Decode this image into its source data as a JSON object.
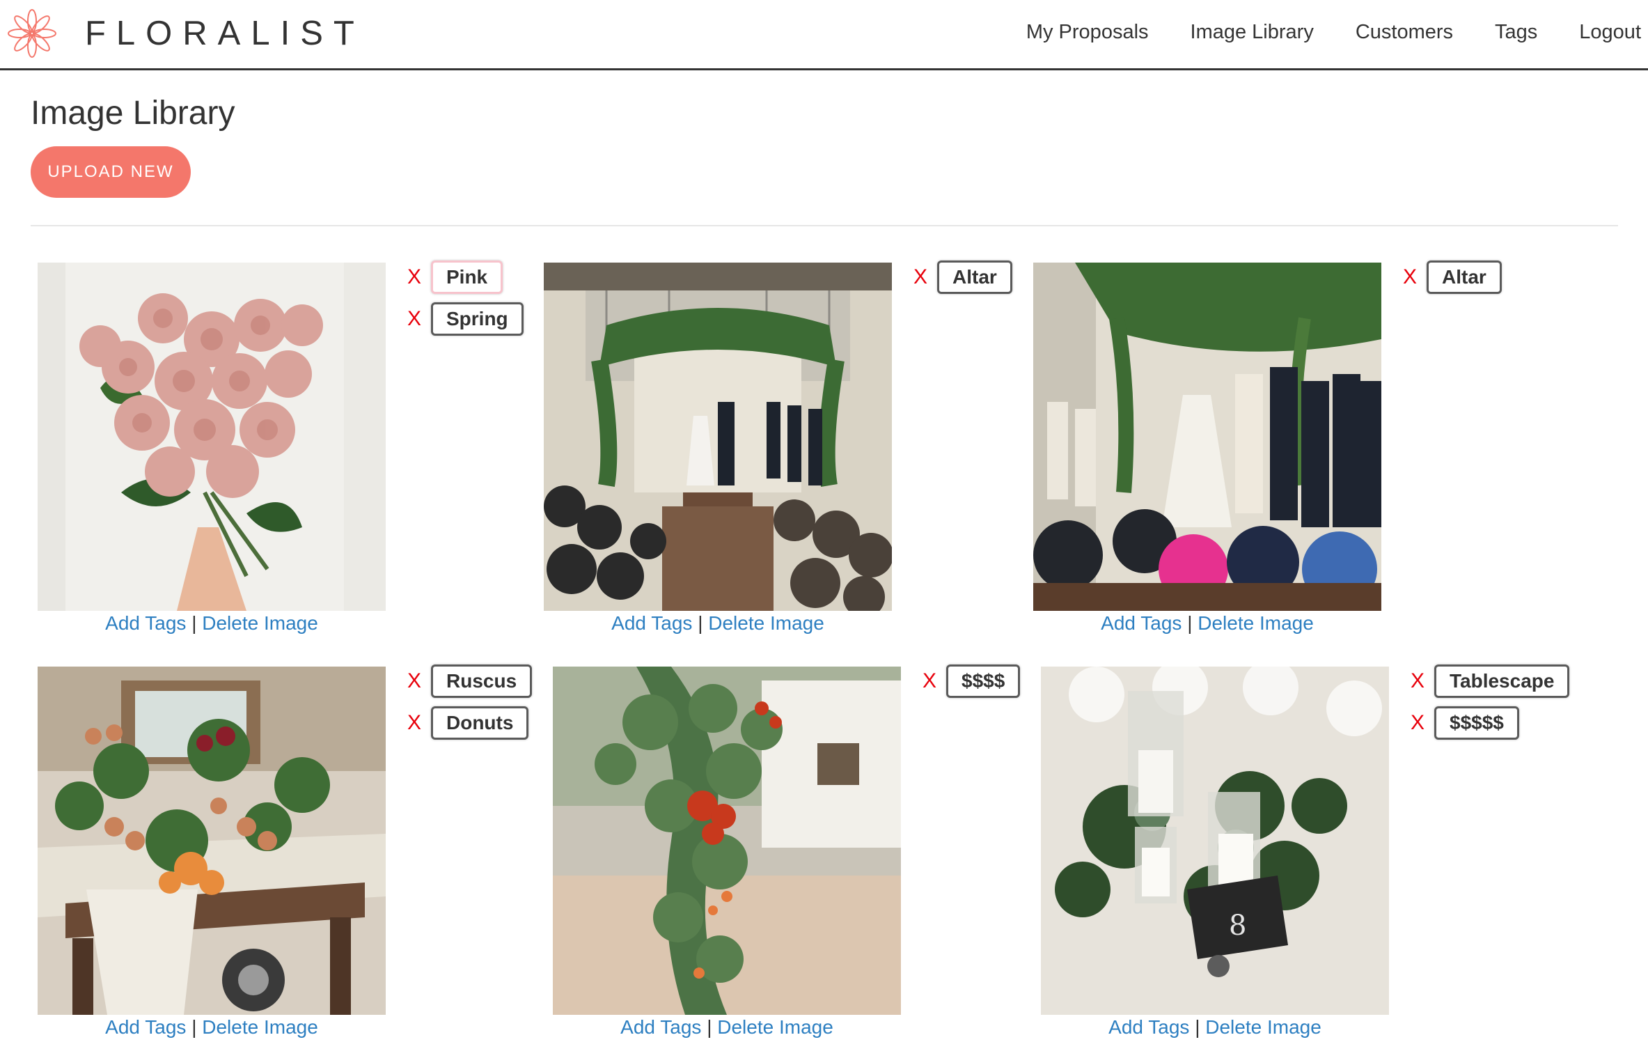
{
  "brand": {
    "name": "FLORALIST",
    "accent": "#f4776b"
  },
  "nav": {
    "items": [
      "My Proposals",
      "Image Library",
      "Customers",
      "Tags",
      "Logout"
    ]
  },
  "page": {
    "title": "Image Library",
    "upload_label": "UPLOAD NEW"
  },
  "cards": [
    {
      "tags": [
        "Pink",
        "Spring"
      ],
      "add_label": "Add Tags",
      "sep": "|",
      "delete_label": "Delete Image"
    },
    {
      "tags": [
        "Altar"
      ],
      "add_label": "Add Tags",
      "sep": "|",
      "delete_label": "Delete Image"
    },
    {
      "tags": [
        "Altar"
      ],
      "add_label": "Add Tags",
      "sep": "|",
      "delete_label": "Delete Image"
    },
    {
      "tags": [
        "Ruscus",
        "Donuts"
      ],
      "add_label": "Add Tags",
      "sep": "|",
      "delete_label": "Delete Image"
    },
    {
      "tags": [
        "$$$$"
      ],
      "add_label": "Add Tags",
      "sep": "|",
      "delete_label": "Delete Image"
    },
    {
      "tags": [
        "Tablescape",
        "$$$$$"
      ],
      "add_label": "Add Tags",
      "sep": "|",
      "delete_label": "Delete Image"
    }
  ],
  "remove_tag_symbol": "X"
}
